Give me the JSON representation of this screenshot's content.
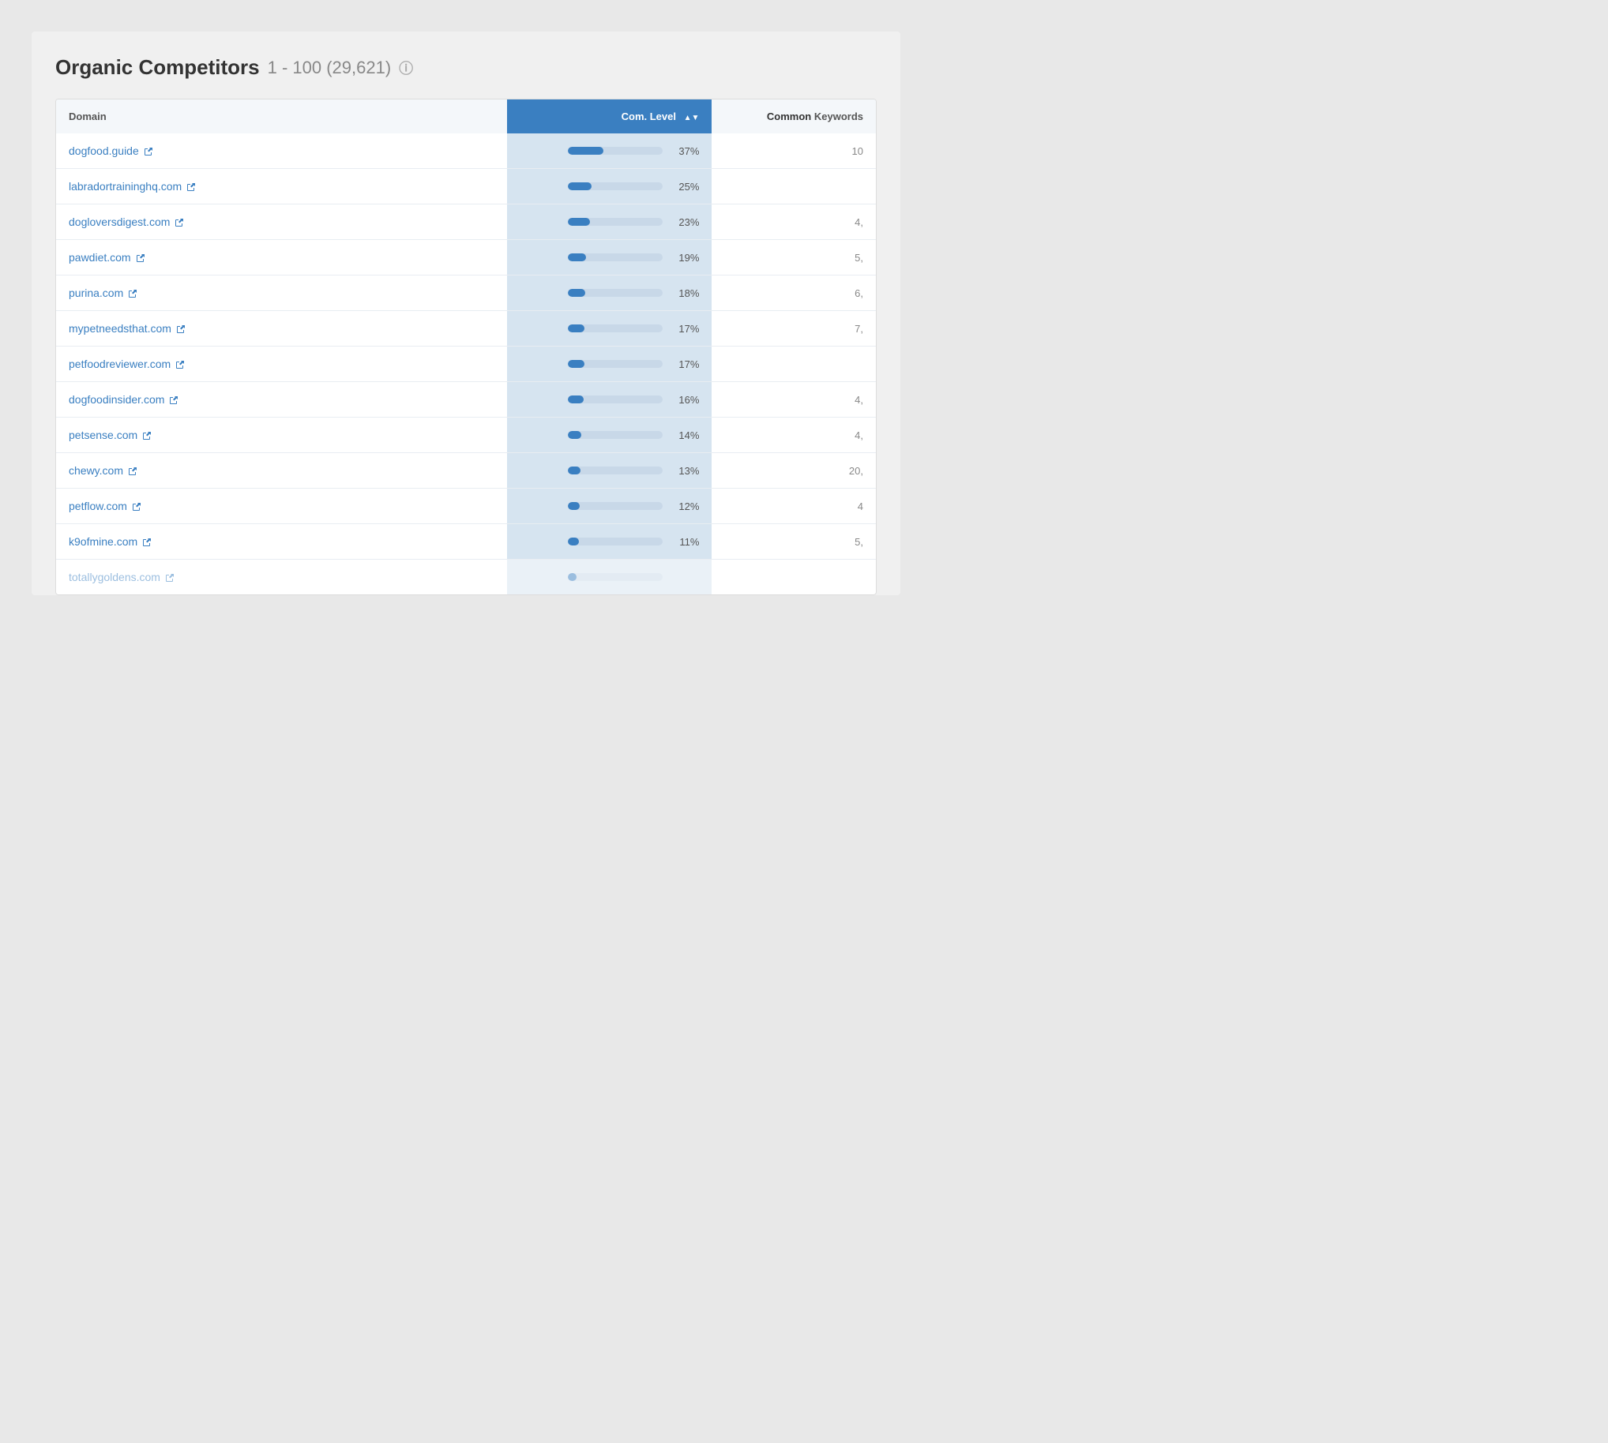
{
  "header": {
    "title": "Organic Competitors",
    "range": "1 - 100 (29,621)",
    "info_tooltip": "Information"
  },
  "table": {
    "columns": {
      "domain_label": "Domain",
      "com_level_label": "Com. Level",
      "keywords_label_bold": "Common",
      "keywords_label_rest": " Keywords"
    },
    "rows": [
      {
        "domain": "dogfood.guide",
        "pct": 37,
        "pct_label": "37%",
        "keywords": "10",
        "faded": false
      },
      {
        "domain": "labradortraininghq.com",
        "pct": 25,
        "pct_label": "25%",
        "keywords": "",
        "faded": false
      },
      {
        "domain": "dogloversdigest.com",
        "pct": 23,
        "pct_label": "23%",
        "keywords": "4,",
        "faded": false
      },
      {
        "domain": "pawdiet.com",
        "pct": 19,
        "pct_label": "19%",
        "keywords": "5,",
        "faded": false
      },
      {
        "domain": "purina.com",
        "pct": 18,
        "pct_label": "18%",
        "keywords": "6,",
        "faded": false
      },
      {
        "domain": "mypetneedsthat.com",
        "pct": 17,
        "pct_label": "17%",
        "keywords": "7,",
        "faded": false
      },
      {
        "domain": "petfoodreviewer.com",
        "pct": 17,
        "pct_label": "17%",
        "keywords": "",
        "faded": false
      },
      {
        "domain": "dogfoodinsider.com",
        "pct": 16,
        "pct_label": "16%",
        "keywords": "4,",
        "faded": false
      },
      {
        "domain": "petsense.com",
        "pct": 14,
        "pct_label": "14%",
        "keywords": "4,",
        "faded": false
      },
      {
        "domain": "chewy.com",
        "pct": 13,
        "pct_label": "13%",
        "keywords": "20,",
        "faded": false
      },
      {
        "domain": "petflow.com",
        "pct": 12,
        "pct_label": "12%",
        "keywords": "4",
        "faded": false
      },
      {
        "domain": "k9ofmine.com",
        "pct": 11,
        "pct_label": "11%",
        "keywords": "5,",
        "faded": false
      },
      {
        "domain": "totallygoldens.com",
        "pct": 9,
        "pct_label": "",
        "keywords": "",
        "faded": true
      }
    ]
  }
}
